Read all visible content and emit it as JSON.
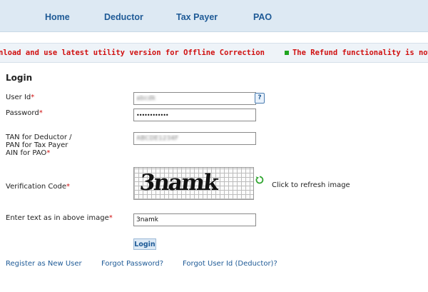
{
  "nav": {
    "items": [
      {
        "label": "Home"
      },
      {
        "label": "Deductor"
      },
      {
        "label": "Tax Payer"
      },
      {
        "label": "PAO"
      }
    ]
  },
  "ticker": {
    "message1": "nload and use latest utility version for Offline Correction",
    "message2": "The Refund functionality is now ena",
    "color": "#d01010",
    "bullet_color": "#1fa51f"
  },
  "login": {
    "title": "Login",
    "user_id_label": "User Id",
    "user_id_value": "abcdk",
    "password_label": "Password",
    "password_value": "••••••••••••",
    "tan_label_line1": "TAN for Deductor /",
    "tan_label_line2": "PAN for Tax Payer",
    "tan_label_line3": "AIN for PAO",
    "tan_value": "ABCDE1234F",
    "verification_label": "Verification Code",
    "captcha_text": "3namk",
    "refresh_text": "Click to refresh image",
    "enter_text_label": "Enter text as in above image",
    "enter_text_value": "3namk",
    "required_mark": "*",
    "login_button": "Login",
    "help_icon": "?"
  },
  "links": {
    "register": "Register as New User",
    "forgot_password": "Forgot Password?",
    "forgot_user_id": "Forgot User Id (Deductor)?"
  },
  "colors": {
    "nav_bg": "#dde9f3",
    "nav_text": "#1e5a96",
    "required": "#d01010",
    "link": "#1e5a96"
  }
}
